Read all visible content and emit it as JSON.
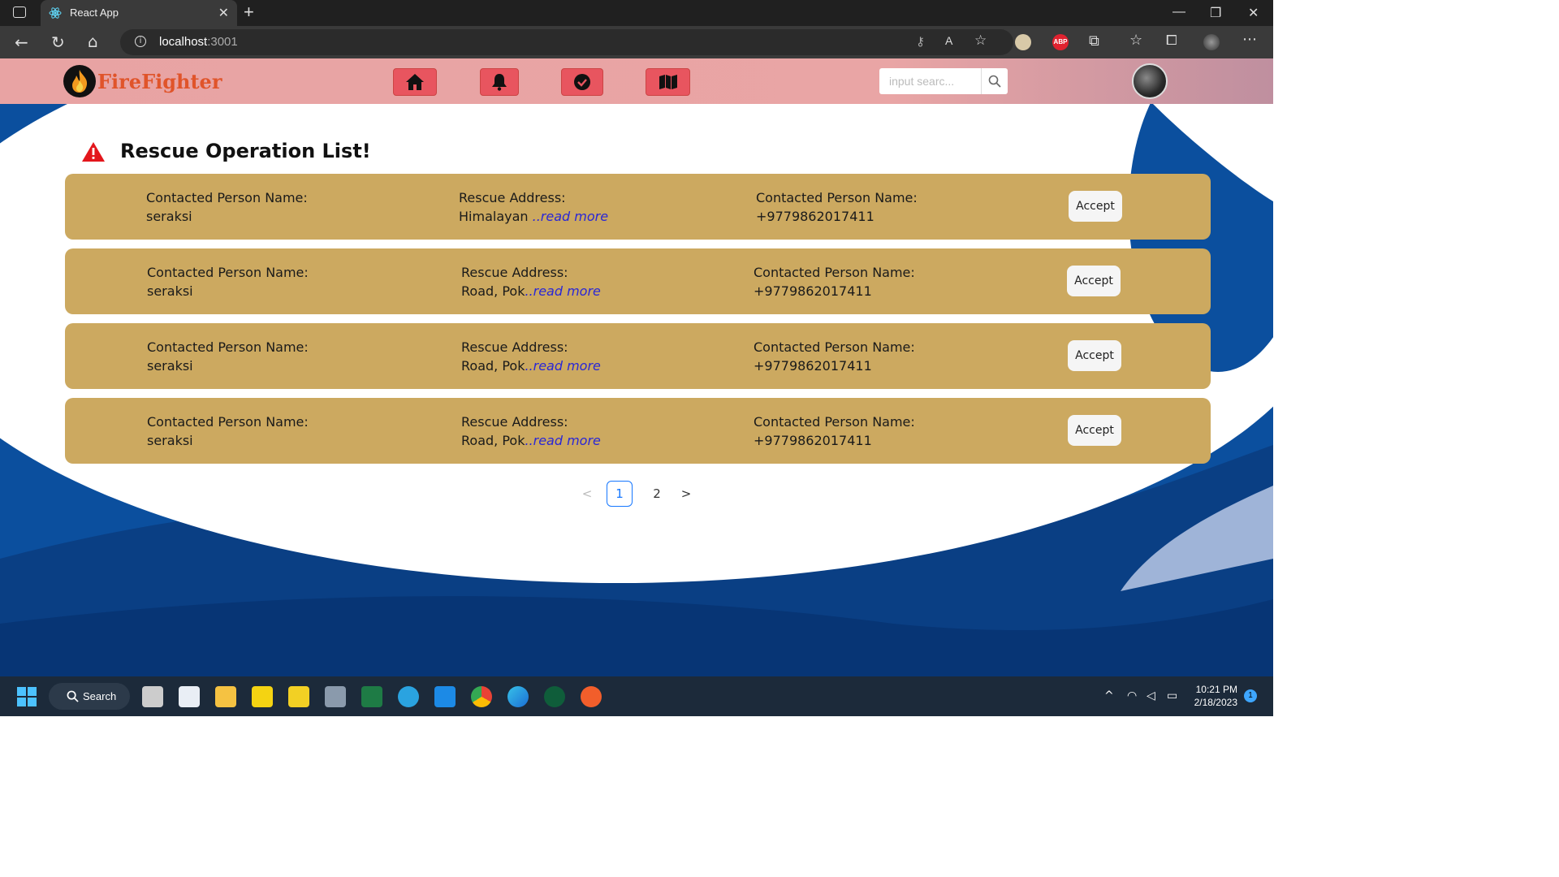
{
  "browser": {
    "tab_title": "React App",
    "url_host": "localhost",
    "url_port": ":3001"
  },
  "app": {
    "logo_text": "FireFighter",
    "nav_icons": [
      "home-icon",
      "bell-icon",
      "check-circle-icon",
      "map-icon"
    ],
    "search_placeholder": "input searc..."
  },
  "page": {
    "title": "Rescue Operation List!",
    "cards": [
      {
        "name_label": "Contacted Person Name:",
        "name_value": "seraksi",
        "address_label": "Rescue Address:",
        "address_value": "Himalayan ",
        "read_more": "..read more",
        "phone_label": "Contacted Person Name:",
        "phone_value": "+9779862017411",
        "accept_label": "Accept"
      },
      {
        "name_label": "Contacted Person Name:",
        "name_value": "seraksi",
        "address_label": "Rescue Address:",
        "address_value": "Road, Pok",
        "read_more": "..read more",
        "phone_label": "Contacted Person Name:",
        "phone_value": "+9779862017411",
        "accept_label": "Accept"
      },
      {
        "name_label": "Contacted Person Name:",
        "name_value": "seraksi",
        "address_label": "Rescue Address:",
        "address_value": "Road, Pok",
        "read_more": "..read more",
        "phone_label": "Contacted Person Name:",
        "phone_value": "+9779862017411",
        "accept_label": "Accept"
      },
      {
        "name_label": "Contacted Person Name:",
        "name_value": "seraksi",
        "address_label": "Rescue Address:",
        "address_value": "Road, Pok",
        "read_more": "..read more",
        "phone_label": "Contacted Person Name:",
        "phone_value": "+9779862017411",
        "accept_label": "Accept"
      }
    ],
    "pagination": {
      "prev": "<",
      "pages": [
        "1",
        "2"
      ],
      "active": "1",
      "next": ">"
    }
  },
  "taskbar": {
    "search_label": "Search",
    "time": "10:21 PM",
    "date": "2/18/2023",
    "notification_count": "1"
  },
  "colors": {
    "appbar": "#e8a3a3",
    "card": "#cca960",
    "nav_button": "#e8555f",
    "read_more": "#2a27d6",
    "logo_text": "#e0542a"
  }
}
